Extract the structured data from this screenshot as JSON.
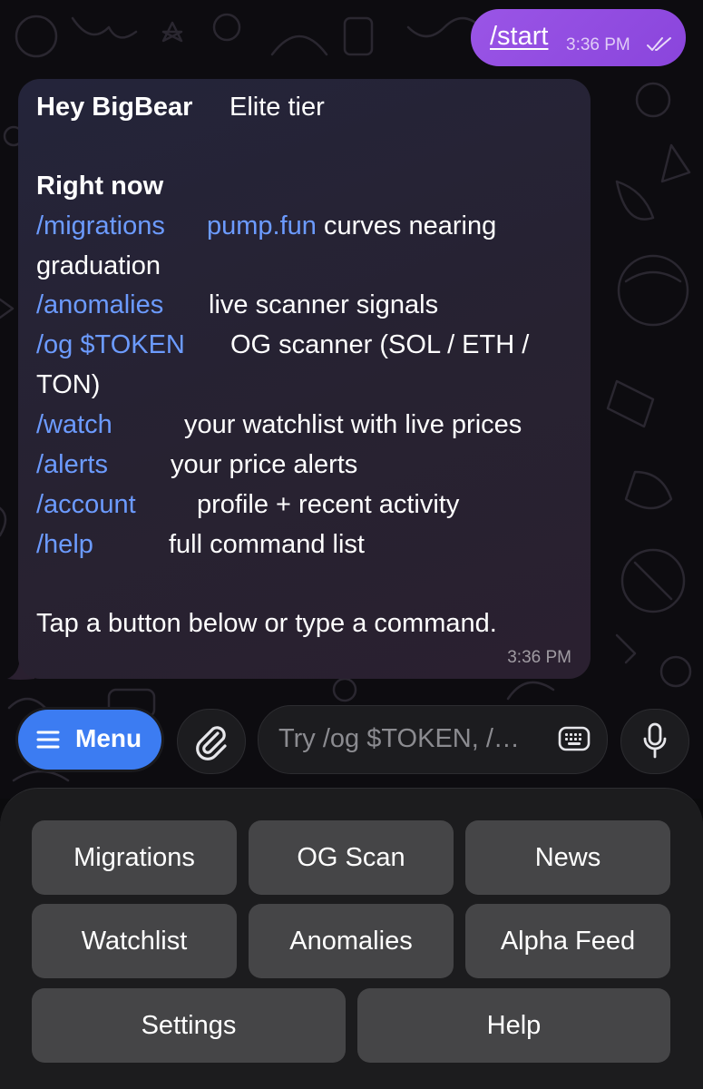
{
  "outgoing": {
    "text": "/start",
    "time": "3:36 PM",
    "status_icon": "double-check-icon"
  },
  "incoming": {
    "greeting": "Hey BigBear",
    "tier": "Elite tier",
    "section_title": "Right now",
    "commands": [
      {
        "cmd": "/migrations",
        "desc_link": "pump.fun",
        "desc": "curves nearing",
        "desc_cont": "graduation"
      },
      {
        "cmd": "/anomalies",
        "desc": "live scanner signals"
      },
      {
        "cmd": "/og $TOKEN",
        "desc": "OG scanner (SOL / ETH /",
        "desc_cont": "TON)"
      },
      {
        "cmd": "/watch",
        "desc": "your watchlist with live prices"
      },
      {
        "cmd": "/alerts",
        "desc": "your price alerts"
      },
      {
        "cmd": "/account",
        "desc": "profile + recent activity"
      },
      {
        "cmd": "/help",
        "desc": "full command list"
      }
    ],
    "footer": "Tap a button below or type a command.",
    "time": "3:36 PM"
  },
  "input_bar": {
    "menu_label": "Menu",
    "placeholder": "Try /og $TOKEN, /…",
    "menu_icon": "hamburger-icon",
    "attach_icon": "paperclip-icon",
    "keyboard_icon": "keyboard-icon",
    "mic_icon": "microphone-icon"
  },
  "keyboard": {
    "buttons": [
      "Migrations",
      "OG Scan",
      "News",
      "Watchlist",
      "Anomalies",
      "Alpha Feed",
      "Settings",
      "Help"
    ]
  },
  "colors": {
    "outgoing_bubble": "#9a55e6",
    "incoming_bubble": "#26233a",
    "command_link": "#6c9bff",
    "menu_button": "#3c7cf2",
    "keyboard_button": "#454547"
  }
}
